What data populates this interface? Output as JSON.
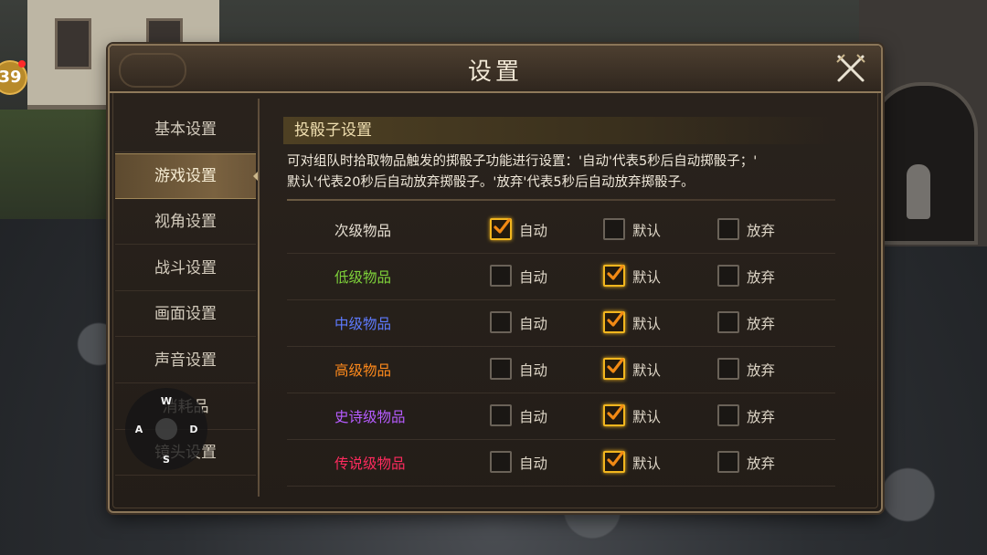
{
  "hud": {
    "level": "39"
  },
  "dialog": {
    "title": "设置",
    "close_icon": "close-swords-icon"
  },
  "sidebar": {
    "items": [
      {
        "label": "基本设置",
        "active": false
      },
      {
        "label": "游戏设置",
        "active": true
      },
      {
        "label": "视角设置",
        "active": false
      },
      {
        "label": "战斗设置",
        "active": false
      },
      {
        "label": "画面设置",
        "active": false
      },
      {
        "label": "声音设置",
        "active": false
      },
      {
        "label": "消耗品",
        "active": false
      },
      {
        "label": "镜头设置",
        "active": false
      }
    ]
  },
  "content": {
    "section_title": "投骰子设置",
    "description_line1": "可对组队时拾取物品触发的掷骰子功能进行设置：'自动'代表5秒后自动掷骰子；'",
    "description_line2": "默认'代表20秒后自动放弃掷骰子。'放弃'代表5秒后自动放弃掷骰子。",
    "option_labels": [
      "自动",
      "默认",
      "放弃"
    ],
    "rows": [
      {
        "label": "次级物品",
        "color": "#e6dfd2",
        "selected": 0
      },
      {
        "label": "低级物品",
        "color": "#7ed23a",
        "selected": 1
      },
      {
        "label": "中级物品",
        "color": "#5e7bff",
        "selected": 1
      },
      {
        "label": "高级物品",
        "color": "#ff8a1c",
        "selected": 1
      },
      {
        "label": "史诗级物品",
        "color": "#b65cff",
        "selected": 1
      },
      {
        "label": "传说级物品",
        "color": "#ff2b5e",
        "selected": 1
      }
    ]
  },
  "joystick": {
    "up": "W",
    "left": "A",
    "right": "D",
    "down": "S"
  },
  "colors": {
    "accent": "#f2b61e",
    "panel": "#231d18",
    "border": "#8a7558"
  }
}
